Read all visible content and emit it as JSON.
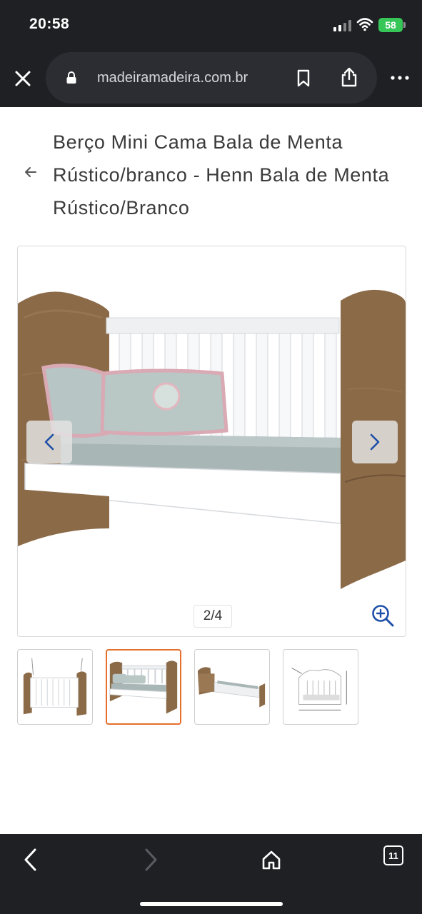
{
  "status_bar": {
    "time": "20:58",
    "battery": "58",
    "battery_color": "#37c759"
  },
  "browser": {
    "url": "madeiramadeira.com.br",
    "close_icon": "close-icon",
    "lock_icon": "lock-icon",
    "bookmark_icon": "bookmark-icon",
    "share_icon": "share-icon",
    "more_icon": "more-icon"
  },
  "product": {
    "back_icon": "back-arrow-icon",
    "title": "Berço Mini Cama Bala de Menta Rústico/branco - Henn Bala de Menta Rústico/Branco"
  },
  "gallery": {
    "counter": "2/4",
    "prev_icon": "chevron-left-icon",
    "next_icon": "chevron-right-icon",
    "zoom_icon": "zoom-in-icon",
    "accent_color": "#1e50a8",
    "selected_thumb_color": "#e56f2c",
    "selected_index": 2,
    "thumbnails": [
      {
        "name": "thumbnail-crib"
      },
      {
        "name": "thumbnail-mini-bed"
      },
      {
        "name": "thumbnail-bed-side"
      },
      {
        "name": "thumbnail-dimensions"
      }
    ]
  },
  "bottom_toolbar": {
    "back_icon": "back-icon",
    "forward_icon": "forward-icon",
    "home_icon": "home-icon",
    "tabs_icon": "tabs-icon",
    "tabs_count": "11"
  }
}
